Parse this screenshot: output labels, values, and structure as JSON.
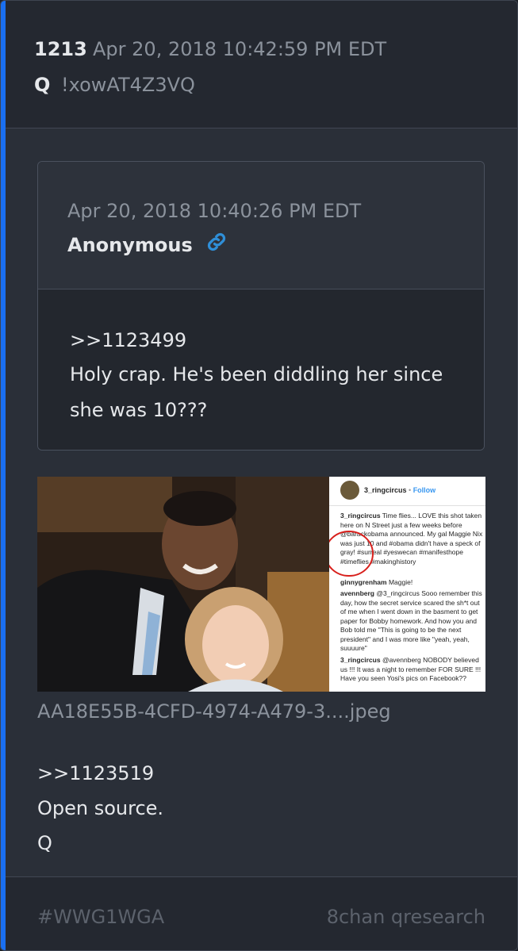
{
  "post": {
    "number": "1213",
    "date": "Apr 20, 2018 10:42:59 PM EDT",
    "author": "Q",
    "tripcode": "!xowAT4Z3VQ"
  },
  "quoted": {
    "date": "Apr 20, 2018 10:40:26 PM EDT",
    "author": "Anonymous",
    "link_icon": "link-icon",
    "body_lines": [
      ">>1123499",
      "Holy crap. He's been diddling her since",
      "she was 10???"
    ]
  },
  "image": {
    "filename": "AA18E55B-4CFD-4974-A479-3....jpeg",
    "instagram": {
      "username": "3_ringcircus",
      "follow": "Follow",
      "comments": [
        {
          "user": "3_ringcircus",
          "text": "Time flies... LOVE this shot taken here on N Street just a few weeks before @barackobama announced. My gal Maggie Nix was just 10 and #obama didn't have a speck of gray! #surreal #yeswecan #manifesthope #timeflies #makinghistory"
        },
        {
          "user": "ginnygrenham",
          "text": "Maggie!"
        },
        {
          "user": "avennberg",
          "text": "@3_ringcircus Sooo remember this day, how the secret service scared the sh*t out of me when I went down in the basment to get paper for Bobby homework. And how you and Bob told me \"This is going to be the next president\" and I was more like \"yeah, yeah, suuuure\""
        },
        {
          "user": "3_ringcircus",
          "text": "@avennberg NOBODY believed us !!! It was a night to remember FOR SURE !!! Have you seen Yosi's pics on Facebook??"
        }
      ]
    }
  },
  "body_lines": [
    ">>1123519",
    "Open source.",
    "Q"
  ],
  "footer": {
    "hashtag": "#WWG1WGA",
    "source": "8chan qresearch"
  },
  "colors": {
    "accent": "#1a6ff0",
    "link": "#2f8fd8"
  }
}
